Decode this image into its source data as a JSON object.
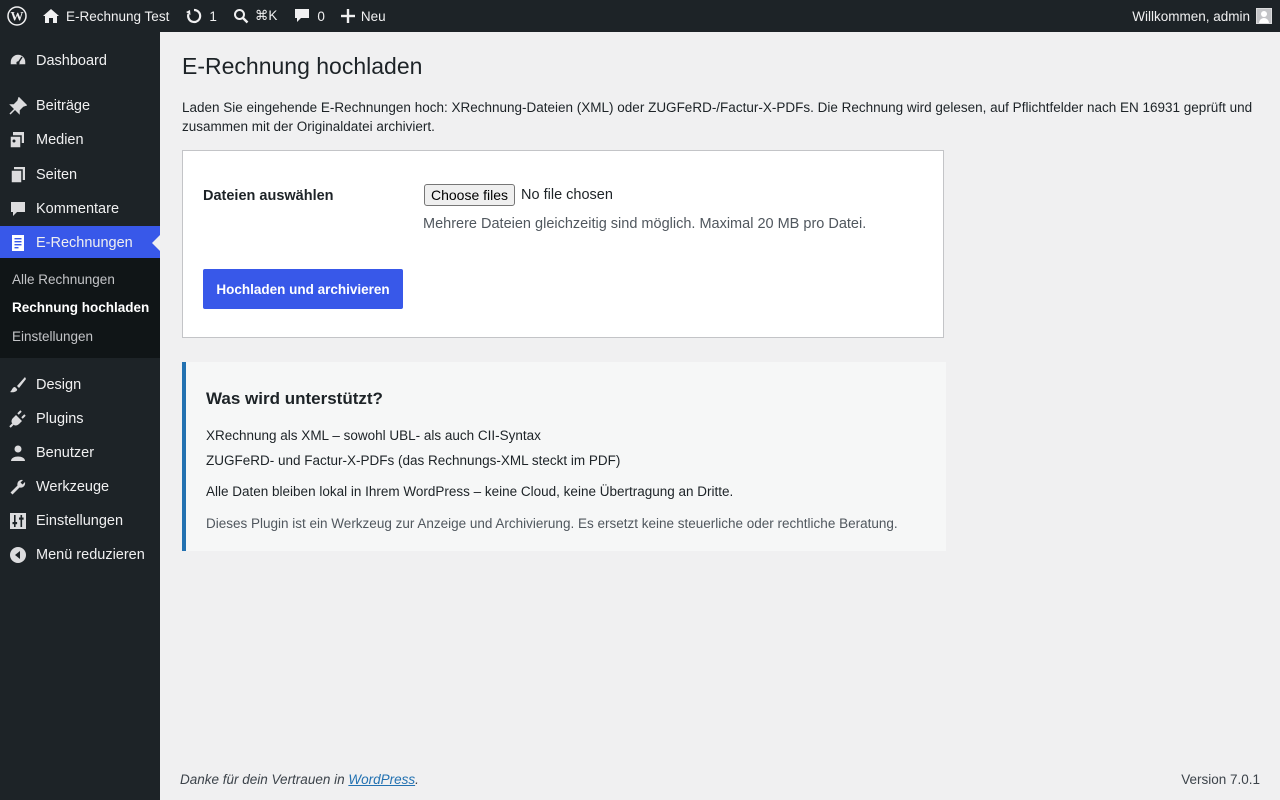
{
  "adminbar": {
    "site_name": "E-Rechnung Test",
    "updates_count": "1",
    "search_label": "⌘K",
    "comments_count": "0",
    "new_label": "Neu",
    "greeting": "Willkommen, admin"
  },
  "sidebar": {
    "items": [
      {
        "label": "Dashboard",
        "icon": "dashboard-icon"
      },
      {
        "label": "Beiträge",
        "icon": "pin-icon"
      },
      {
        "label": "Medien",
        "icon": "media-icon"
      },
      {
        "label": "Seiten",
        "icon": "pages-icon"
      },
      {
        "label": "Kommentare",
        "icon": "comment-icon"
      },
      {
        "label": "E-Rechnungen",
        "icon": "invoice-icon"
      },
      {
        "label": "Design",
        "icon": "brush-icon"
      },
      {
        "label": "Plugins",
        "icon": "plugin-icon"
      },
      {
        "label": "Benutzer",
        "icon": "user-icon"
      },
      {
        "label": "Werkzeuge",
        "icon": "wrench-icon"
      },
      {
        "label": "Einstellungen",
        "icon": "settings-icon"
      },
      {
        "label": "Menü reduzieren",
        "icon": "collapse-icon"
      }
    ],
    "submenu": [
      "Alle Rechnungen",
      "Rechnung hochladen",
      "Einstellungen"
    ]
  },
  "main": {
    "title": "E-Rechnung hochladen",
    "intro": "Laden Sie eingehende E-Rechnungen hoch: XRechnung-Dateien (XML) oder ZUGFeRD-/Factur-X-PDFs. Die Rechnung wird gelesen, auf Pflichtfelder nach EN 16931 geprüft und zusammen mit der Originaldatei archiviert.",
    "upload": {
      "field_label": "Dateien auswählen",
      "file_button": "Choose files",
      "file_status": "No file chosen",
      "hint": "Mehrere Dateien gleichzeitig sind möglich. Maximal 20 MB pro Datei.",
      "submit_label": "Hochladen und archivieren"
    },
    "info": {
      "heading": "Was wird unterstützt?",
      "line1": "XRechnung als XML – sowohl UBL- als auch CII-Syntax",
      "line2": "ZUGFeRD- und Factur-X-PDFs (das Rechnungs-XML steckt im PDF)",
      "line3": "Alle Daten bleiben lokal in Ihrem WordPress – keine Cloud, keine Übertragung an Dritte.",
      "disclaimer": "Dieses Plugin ist ein Werkzeug zur Anzeige und Archivierung. Es ersetzt keine steuerliche oder rechtliche Beratung."
    }
  },
  "footer": {
    "thanks_prefix": "Danke für dein Vertrauen in ",
    "thanks_link": "WordPress",
    "thanks_suffix": ".",
    "version": "Version 7.0.1"
  },
  "colors": {
    "admin_bg": "#1d2327",
    "accent": "#3858e9",
    "notice_border": "#2271b1"
  }
}
